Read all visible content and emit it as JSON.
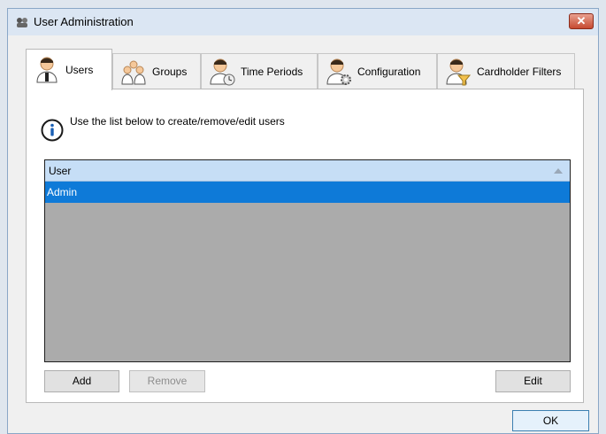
{
  "window": {
    "title": "User Administration",
    "close_label": "✕"
  },
  "tabs": [
    {
      "label": "Users",
      "icon": "user-icon"
    },
    {
      "label": "Groups",
      "icon": "group-icon"
    },
    {
      "label": "Time Periods",
      "icon": "user-clock-icon"
    },
    {
      "label": "Configuration",
      "icon": "user-gear-icon"
    },
    {
      "label": "Cardholder Filters",
      "icon": "user-filter-icon"
    }
  ],
  "info": {
    "text": "Use the list below to create/remove/edit users",
    "icon": "info-icon"
  },
  "list": {
    "column": "User",
    "rows": [
      "Admin"
    ],
    "selected_row": "Admin"
  },
  "buttons": {
    "add": "Add",
    "remove": "Remove",
    "edit": "Edit",
    "ok": "OK"
  },
  "colors": {
    "selection": "#0e7ad8",
    "list_background": "#ababab",
    "header": "#c6def6"
  }
}
